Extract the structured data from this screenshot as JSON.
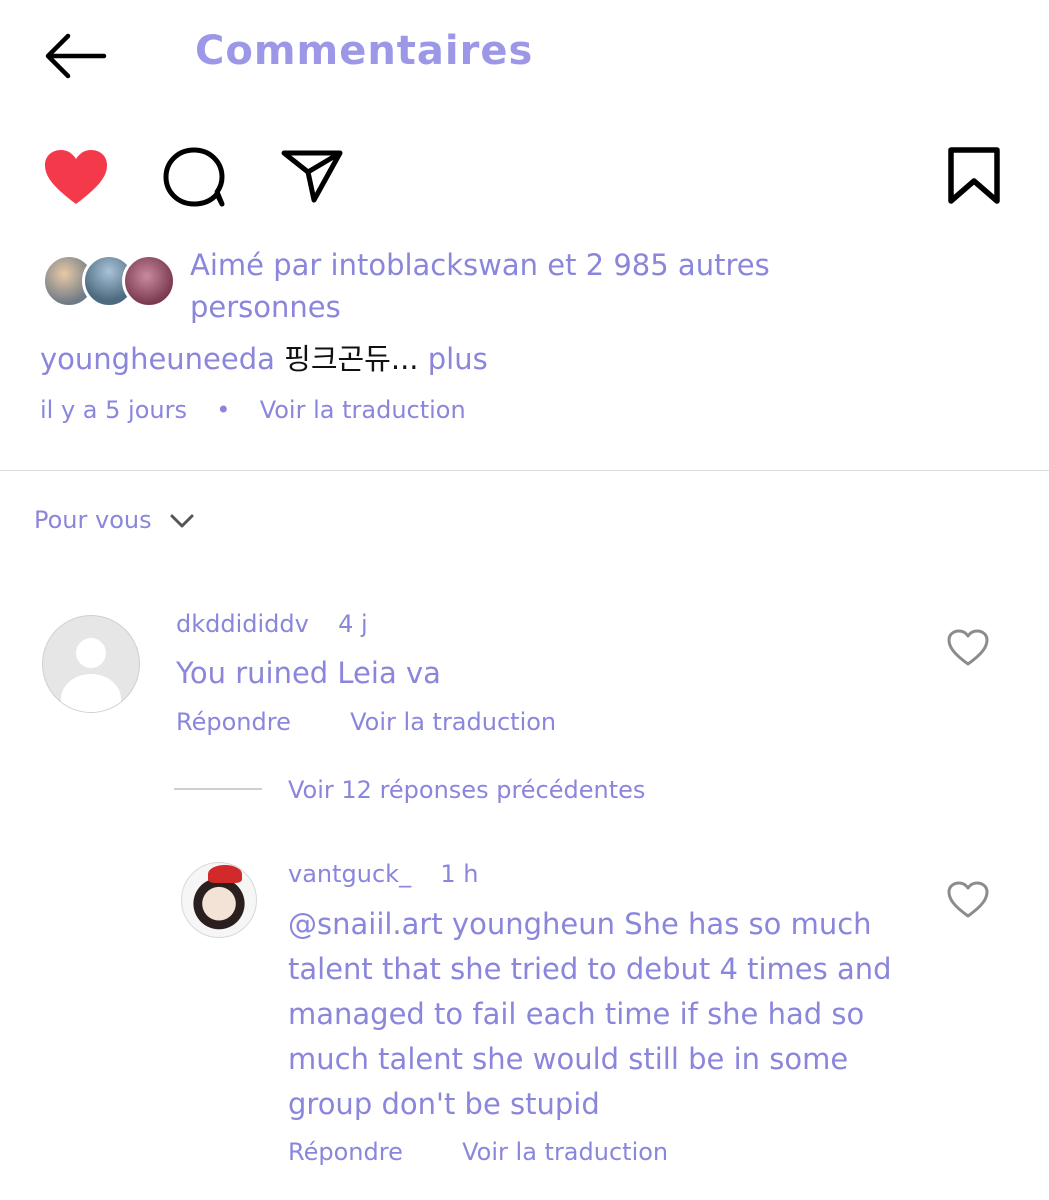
{
  "header": {
    "title": "Commentaires"
  },
  "post": {
    "liked_by": "Aimé par intoblackswan et 2 985 autres personnes",
    "caption_user": "youngheuneeda",
    "caption_text": "핑크곤듀...",
    "caption_more": "plus",
    "time_ago": "il y a 5 jours",
    "separator": "•",
    "translate": "Voir la traduction"
  },
  "sort": {
    "label": "Pour vous"
  },
  "comments": [
    {
      "user": "dkddididdv",
      "time": "4 j",
      "text": "You ruined Leia va",
      "reply": "Répondre",
      "translate": "Voir la traduction"
    }
  ],
  "replies_link": "Voir 12 réponses précédentes",
  "reply": {
    "user": "vantguck_",
    "time": "1 h",
    "text": "@snaiil.art youngheun She has so much talent that she tried to debut 4 times and managed to fail each time if she had so much talent she would still be in some group don't be stupid",
    "reply": "Répondre",
    "translate": "Voir la traduction"
  },
  "colors": {
    "accent": "#8a86dc",
    "heart": "#f4394b"
  },
  "icons": [
    "back-arrow-icon",
    "heart-filled-icon",
    "comment-icon",
    "send-icon",
    "bookmark-icon",
    "heart-outline-icon",
    "chevron-down-icon"
  ]
}
